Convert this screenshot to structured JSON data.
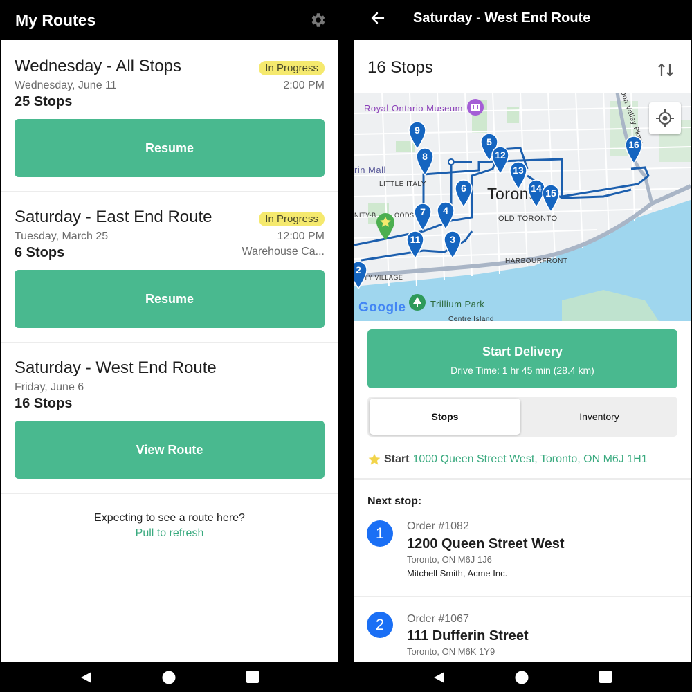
{
  "left": {
    "title": "My Routes",
    "routes": [
      {
        "name": "Wednesday - All Stops",
        "date": "Wednesday, June 11",
        "stops": "25 Stops",
        "badge": "In Progress",
        "time": "2:00 PM",
        "location": "",
        "button": "Resume"
      },
      {
        "name": "Saturday - East End Route",
        "date": "Tuesday, March 25",
        "stops": "6 Stops",
        "badge": "In Progress",
        "time": "12:00 PM",
        "location": "Warehouse Ca...",
        "button": "Resume"
      },
      {
        "name": "Saturday - West End Route",
        "date": "Friday, June 6",
        "stops": "16 Stops",
        "badge": "",
        "time": "",
        "location": "",
        "button": "View Route"
      }
    ],
    "empty_note": "Expecting to see a route here?",
    "refresh_link": "Pull to refresh"
  },
  "right": {
    "title": "Saturday - West End Route",
    "stops_count": "16 Stops",
    "map": {
      "labels": [
        "Royal Ontario Museum",
        "Toronto",
        "LITTLE ITALY",
        "OLD TORONTO",
        "HARBOURFRONT",
        "Trillium Park",
        "Google",
        "Don Valley Pkwy",
        "rin Mall",
        "NITY-B",
        "OODS",
        "TY VILLAGE",
        "Centre Island"
      ],
      "pins": [
        "9",
        "5",
        "8",
        "12",
        "13",
        "6",
        "14",
        "15",
        "16",
        "7",
        "4",
        "11",
        "3",
        "2"
      ]
    },
    "start_delivery": "Start Delivery",
    "drive_time": "Drive Time: 1 hr 45 min (28.4 km)",
    "tabs": [
      "Stops",
      "Inventory"
    ],
    "start_label": "Start",
    "start_address": "1000 Queen Street West, Toronto, ON M6J 1H1",
    "next_stop_label": "Next stop:",
    "stops": [
      {
        "num": "1",
        "order": "Order #1082",
        "address": "1200 Queen Street West",
        "city": "Toronto, ON M6J 1J6",
        "customer": "Mitchell Smith, Acme Inc."
      },
      {
        "num": "2",
        "order": "Order #1067",
        "address": "111 Dufferin Street",
        "city": "Toronto, ON M6K 1Y9",
        "customer": ""
      }
    ]
  },
  "colors": {
    "accent": "#49b98f",
    "badge": "#f5e96e",
    "pin": "#1565c0",
    "stop_number": "#1a6ff5",
    "link": "#3aaa7f"
  }
}
